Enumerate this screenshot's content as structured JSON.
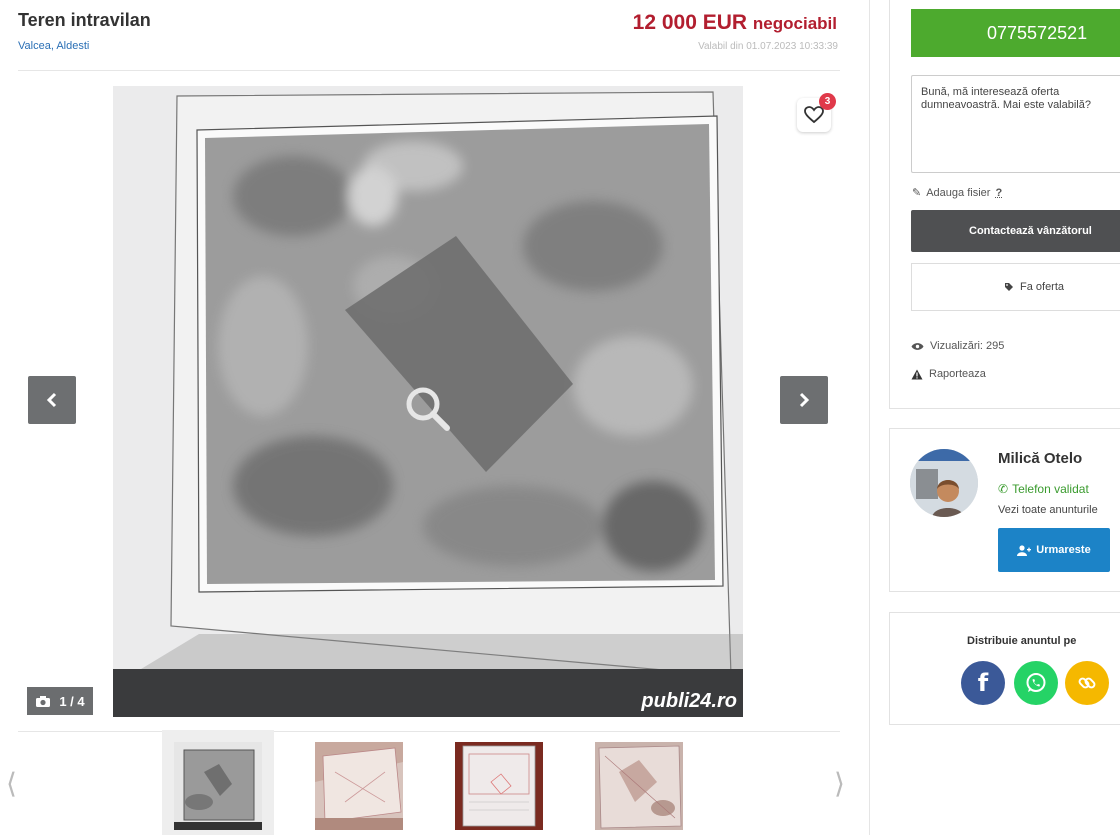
{
  "listing": {
    "title": "Teren intravilan",
    "location": "Valcea, Aldesti",
    "price": "12 000 EUR",
    "price_note": "negociabil",
    "valid_from": "Valabil din 01.07.2023 10:33:39",
    "favorites_count": "3",
    "photo_counter": "1 / 4",
    "watermark": "publi24.ro"
  },
  "contact": {
    "phone": "0775572521",
    "message": "Bună, mă interesează oferta dumneavoastră. Mai este valabilă?",
    "attach_label": "Adauga fisier",
    "attach_help": "?",
    "contact_button": "Contactează vânzătorul",
    "offer_button": "Fa oferta",
    "views": "Vizualizări: 295",
    "report": "Raporteaza"
  },
  "seller": {
    "name": "Milică Otelo",
    "phone_status": "Telefon validat",
    "all_ads": "Vezi toate anunturile",
    "follow_button": "Urmareste"
  },
  "share": {
    "title": "Distribuie anuntul pe",
    "networks": [
      "facebook-icon",
      "whatsapp-icon",
      "link-icon"
    ]
  },
  "colors": {
    "price": "#b21e2f",
    "phone_button": "#4daa2e",
    "contact_button": "#4f5052",
    "follow_button": "#1c83c7",
    "link": "#2a6fb5",
    "badge": "#e0394a"
  }
}
